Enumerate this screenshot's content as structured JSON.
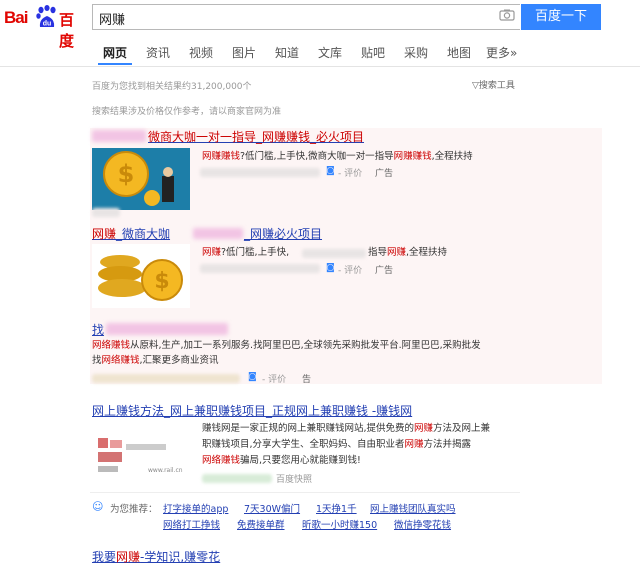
{
  "header": {
    "logo_bai": "Bai",
    "logo_du": "du",
    "logo_cn": "百度",
    "query": "网赚",
    "search_button": "百度一下"
  },
  "tabs": [
    "网页",
    "资讯",
    "视频",
    "图片",
    "知道",
    "文库",
    "贴吧",
    "采购",
    "地图",
    "更多»"
  ],
  "meta": {
    "result_count": "百度为您找到相关结果约31,200,000个",
    "tools": "搜索工具",
    "disclaimer": "搜索结果涉及价格仅作参考，请以商家官网为准"
  },
  "ads": [
    {
      "title_b": "微商大咖一对一指导_网赚赚钱_必火项目",
      "desc_red1": "网赚赚钱",
      "desc_mid": "?低门槛,上手快,微商大咖一对一指导",
      "desc_red2": "网赚赚钱",
      "desc_end": ",全程扶持",
      "rate": "评价",
      "ad": "广告"
    },
    {
      "title_red": "网赚",
      "title_a": "_微商大咖",
      "title_b": "_网赚必火项目",
      "desc_red1": "网赚",
      "desc_mid": "?低门槛,上手快,",
      "desc_mid2": "指导",
      "desc_red2": "网赚",
      "desc_end": ",全程扶持",
      "rate": "评价",
      "ad": "广告"
    },
    {
      "title_a": "找",
      "desc_red1": "网络赚钱",
      "desc_1": "从原料,生产,加工一系列服务.找阿里巴巴,全球领先采购批发平台.阿里巴巴,采购批发",
      "desc_2_pre": "找",
      "desc_red2": "网络赚钱",
      "desc_2_end": ",汇聚更多商业资讯",
      "rate": "评价",
      "ad": "告"
    }
  ],
  "organic": {
    "title": "网上赚钱方法_网上兼职赚钱项目_正规网上兼职赚钱 -赚钱网",
    "line1_a": "赚钱网是一家正规的网上兼职赚钱网站,提供免费的",
    "line1_red": "网赚",
    "line1_b": "方法及网上兼",
    "line2_a": "职赚钱项目,分享大学生、全职妈妈、自由职业者",
    "line2_red": "网赚",
    "line2_b": "方法并揭露",
    "line3_red": "网络赚钱",
    "line3_b": "骗局,只要您用心就能赚到钱!",
    "snapshot": "百度快照",
    "thumb_text": "www.rail.cn"
  },
  "recommend": {
    "label": "为您推荐：",
    "row1": [
      "打字接单的app",
      "7天30W偏门",
      "1天挣1千",
      "网上赚钱团队真实吗"
    ],
    "row2": [
      "网络打工挣钱",
      "免费接单群",
      "昕歌一小时赚150",
      "微信挣零花钱"
    ]
  },
  "last": {
    "title_a": "我要",
    "title_red": "网赚",
    "title_b": "-学知识,赚零花"
  },
  "colors": {
    "brand_red": "#e10602",
    "brand_blue": "#3385ff",
    "link": "#2440b3",
    "highlight": "#cc0000"
  }
}
